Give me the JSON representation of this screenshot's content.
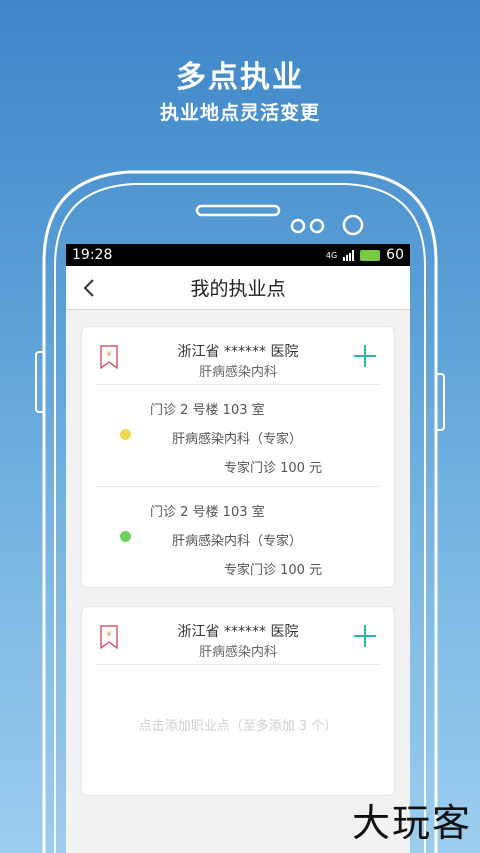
{
  "promo": {
    "headline": "多点执业",
    "subline": "执业地点灵活变更"
  },
  "status_bar": {
    "time": "19:28",
    "network": "4G",
    "battery": "60"
  },
  "nav": {
    "title": "我的执业点",
    "back_icon": "chevron-left-icon"
  },
  "cards": [
    {
      "hospital": "浙江省 ****** 医院",
      "department": "肝病感染内科",
      "practices": [
        {
          "location": "门诊 2 号楼  103 室",
          "department": "肝病感染内科（专家）",
          "fee": "专家门诊   100 元",
          "status_color": "#f1d94e"
        },
        {
          "location": "门诊 2 号楼  103 室",
          "department": "肝病感染内科（专家）",
          "fee": "专家门诊   100 元",
          "status_color": "#6cd25a"
        }
      ]
    },
    {
      "hospital": "浙江省 ****** 医院",
      "department": "肝病感染内科",
      "empty_hint": "点击添加职业点（至多添加 3 个）"
    }
  ],
  "watermark": "大玩客",
  "colors": {
    "accent": "#2bb5a0",
    "hospital_icon": "#e0566a",
    "background_top": "#3f86c8",
    "background_bottom": "#9ccdee"
  }
}
